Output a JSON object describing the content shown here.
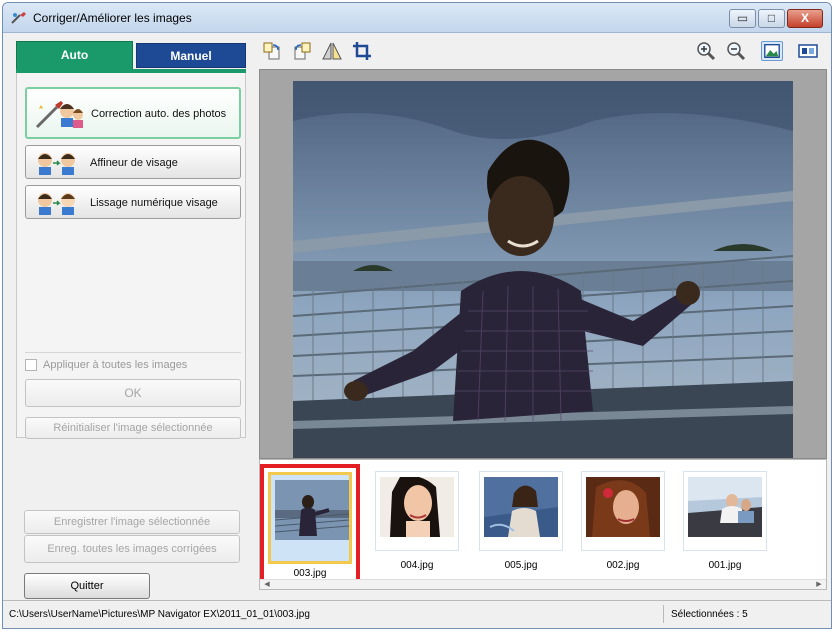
{
  "window": {
    "title": "Corriger/Améliorer les images",
    "min_glyph": "▭",
    "max_glyph": "□",
    "close_glyph": "X"
  },
  "tabs": {
    "auto": "Auto",
    "manual": "Manuel"
  },
  "tools": {
    "auto_photo_fix": "Correction auto. des photos",
    "face_sharpener": "Affineur de visage",
    "digital_face_smoothing": "Lissage numérique visage"
  },
  "options": {
    "apply_all_label": "Appliquer à toutes les images",
    "ok_label": "OK",
    "reset_label": "Réinitialiser l'image sélectionnée"
  },
  "actions": {
    "save_selected": "Enregistrer l'image sélectionnée",
    "save_all": "Enreg. toutes les images corrigées",
    "quit": "Quitter"
  },
  "toolbar_icons": [
    "rotate-left-icon",
    "rotate-right-icon",
    "mirror-icon",
    "crop-icon",
    "zoom-in-icon",
    "zoom-out-icon",
    "full-image-icon",
    "compare-icon"
  ],
  "thumbnails": [
    {
      "name": "003.jpg",
      "selected": true
    },
    {
      "name": "004.jpg",
      "selected": false
    },
    {
      "name": "005.jpg",
      "selected": false
    },
    {
      "name": "002.jpg",
      "selected": false
    },
    {
      "name": "001.jpg",
      "selected": false
    }
  ],
  "status": {
    "path": "C:\\Users\\UserName\\Pictures\\MP Navigator EX\\2011_01_01\\003.jpg",
    "selected_count": "Sélectionnées : 5"
  },
  "colors": {
    "auto_tab": "#1a9a6a",
    "manual_tab": "#1e4a95",
    "selection_border": "#e41f23",
    "selection_inner": "#f2c94c"
  }
}
